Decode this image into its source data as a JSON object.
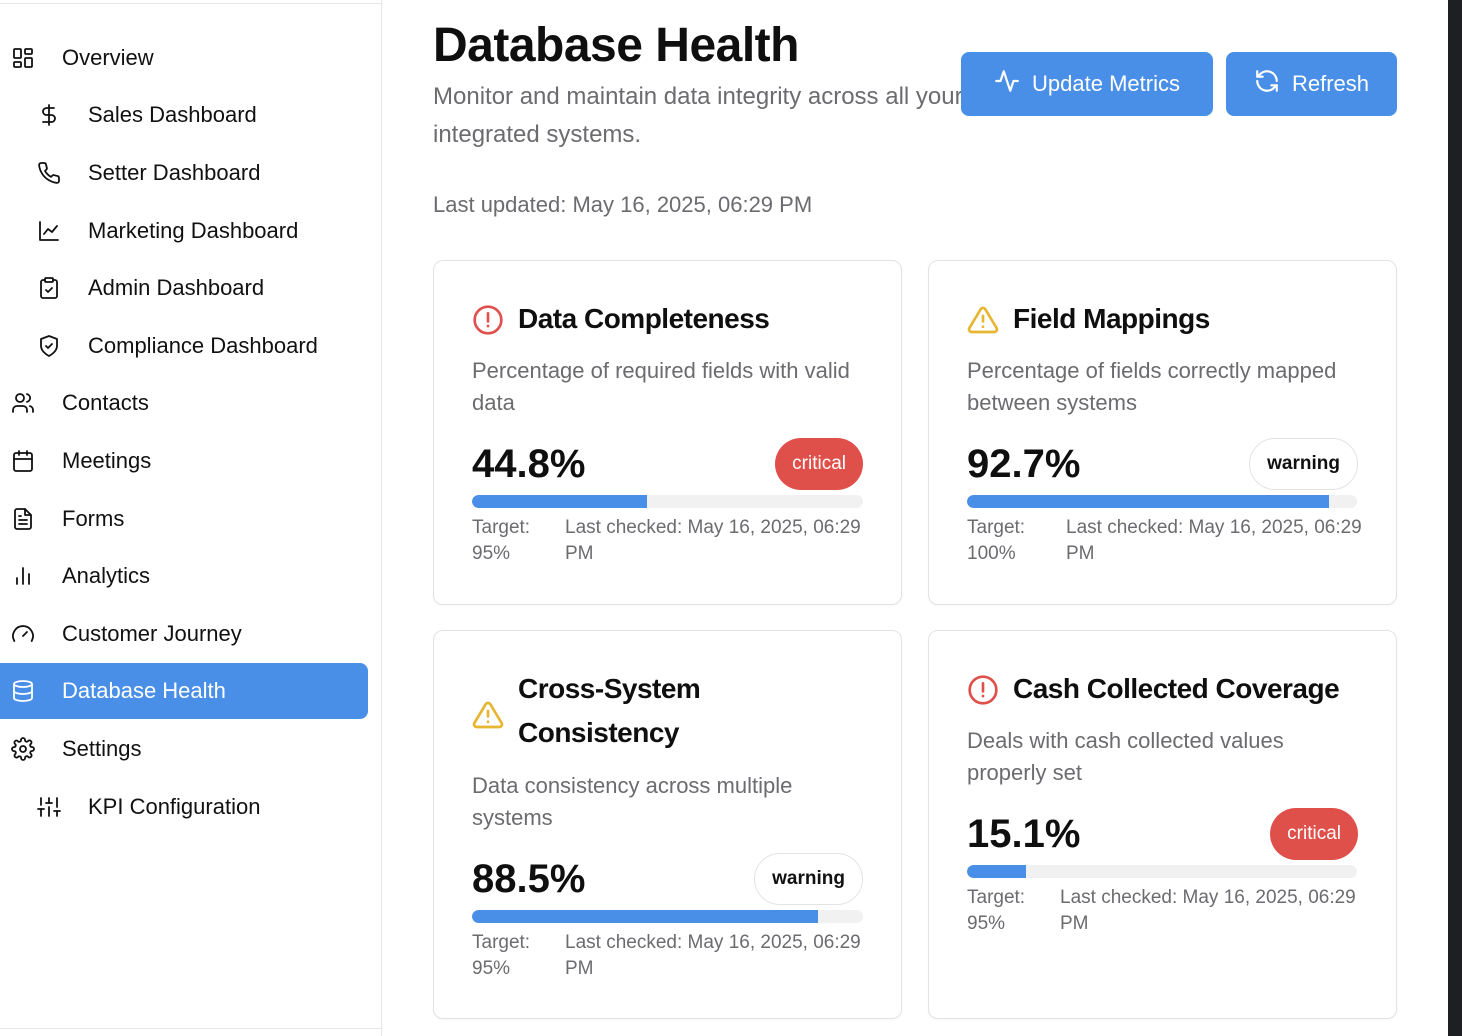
{
  "sidebar": {
    "items": [
      {
        "label": "Overview",
        "icon": "layout-grid-icon",
        "level": "top"
      },
      {
        "label": "Sales Dashboard",
        "icon": "dollar-icon",
        "level": "sub"
      },
      {
        "label": "Setter Dashboard",
        "icon": "phone-icon",
        "level": "sub"
      },
      {
        "label": "Marketing Dashboard",
        "icon": "line-chart-icon",
        "level": "sub"
      },
      {
        "label": "Admin Dashboard",
        "icon": "clipboard-check-icon",
        "level": "sub"
      },
      {
        "label": "Compliance Dashboard",
        "icon": "shield-check-icon",
        "level": "sub"
      },
      {
        "label": "Contacts",
        "icon": "users-icon",
        "level": "top"
      },
      {
        "label": "Meetings",
        "icon": "calendar-icon",
        "level": "top"
      },
      {
        "label": "Forms",
        "icon": "file-text-icon",
        "level": "top"
      },
      {
        "label": "Analytics",
        "icon": "bar-chart-icon",
        "level": "top"
      },
      {
        "label": "Customer Journey",
        "icon": "gauge-icon",
        "level": "top"
      },
      {
        "label": "Database Health",
        "icon": "database-icon",
        "level": "top",
        "active": true
      },
      {
        "label": "Settings",
        "icon": "gear-icon",
        "level": "top"
      },
      {
        "label": "KPI Configuration",
        "icon": "sliders-icon",
        "level": "sub"
      }
    ]
  },
  "header": {
    "title": "Database Health",
    "subtitle": "Monitor and maintain data integrity across all your integrated systems.",
    "last_updated": "Last updated: May 16, 2025, 06:29 PM",
    "update_label": "Update Metrics",
    "refresh_label": "Refresh"
  },
  "cards": [
    {
      "title": "Data Completeness",
      "icon": "alert-circle-icon",
      "description": "Percentage of required fields with valid data",
      "value": "44.8%",
      "progress": 0.448,
      "status": "critical",
      "target": "Target: 95%",
      "last_checked": "Last checked: May 16, 2025, 06:29 PM"
    },
    {
      "title": "Field Mappings",
      "icon": "alert-triangle-icon",
      "description": "Percentage of fields correctly mapped between systems",
      "value": "92.7%",
      "progress": 0.927,
      "status": "warning",
      "target": "Target: 100%",
      "last_checked": "Last checked: May 16, 2025, 06:29 PM"
    },
    {
      "title": "Cross-System Consistency",
      "icon": "alert-triangle-icon",
      "description": "Data consistency across multiple systems",
      "value": "88.5%",
      "progress": 0.885,
      "status": "warning",
      "target": "Target: 95%",
      "last_checked": "Last checked: May 16, 2025, 06:29 PM"
    },
    {
      "title": "Cash Collected Coverage",
      "icon": "alert-circle-icon",
      "description": "Deals with cash collected values properly set",
      "value": "15.1%",
      "progress": 0.151,
      "status": "critical",
      "target": "Target: 95%",
      "last_checked": "Last checked: May 16, 2025, 06:29 PM"
    }
  ],
  "colors": {
    "accent": "#4a8fe7",
    "critical": "#e0504a",
    "warning_icon": "#e8b531",
    "muted_text": "#6b6b70"
  }
}
